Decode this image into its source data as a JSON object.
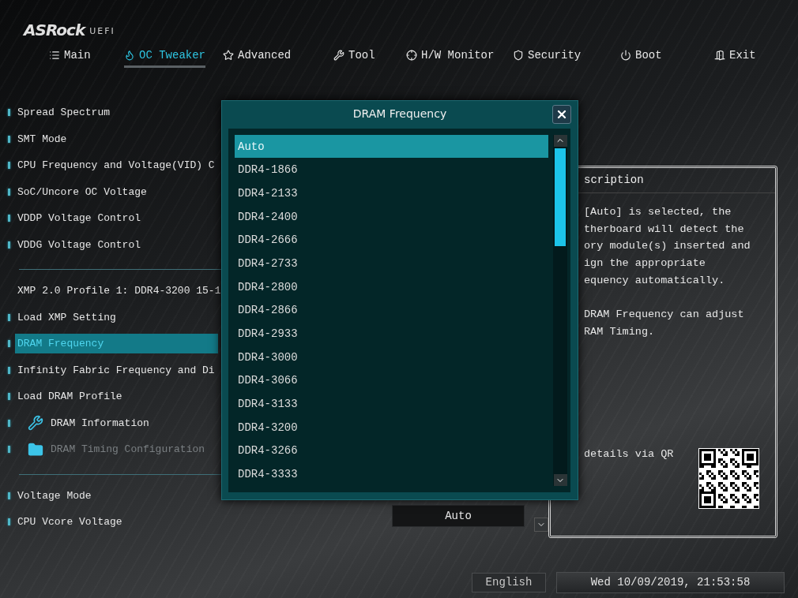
{
  "brand": {
    "logo": "ASRock",
    "suffix": "UEFI"
  },
  "tabs": [
    {
      "label": "Main",
      "selected": false
    },
    {
      "label": "OC Tweaker",
      "selected": true
    },
    {
      "label": "Advanced",
      "selected": false
    },
    {
      "label": "Tool",
      "selected": false
    },
    {
      "label": "H/W Monitor",
      "selected": false
    },
    {
      "label": "Security",
      "selected": false
    },
    {
      "label": "Boot",
      "selected": false
    },
    {
      "label": "Exit",
      "selected": false
    }
  ],
  "settings": [
    {
      "kind": "item",
      "label": "Spread Spectrum",
      "selected": false,
      "disabled": false
    },
    {
      "kind": "item",
      "label": "SMT Mode",
      "selected": false,
      "disabled": false
    },
    {
      "kind": "item",
      "label": "CPU Frequency and Voltage(VID) C",
      "selected": false,
      "disabled": false
    },
    {
      "kind": "item",
      "label": "SoC/Uncore OC Voltage",
      "selected": false,
      "disabled": false
    },
    {
      "kind": "item",
      "label": "VDDP Voltage Control",
      "selected": false,
      "disabled": false
    },
    {
      "kind": "item",
      "label": "VDDG Voltage Control",
      "selected": false,
      "disabled": false
    },
    {
      "kind": "divider"
    },
    {
      "kind": "info",
      "label": "XMP 2.0 Profile 1: DDR4-3200 15-1"
    },
    {
      "kind": "item",
      "label": "Load XMP Setting",
      "selected": false,
      "disabled": false
    },
    {
      "kind": "item",
      "label": "DRAM Frequency",
      "selected": true,
      "disabled": false
    },
    {
      "kind": "item",
      "label": "Infinity Fabric Frequency and Di",
      "selected": false,
      "disabled": false
    },
    {
      "kind": "item",
      "label": "Load DRAM Profile",
      "selected": false,
      "disabled": false
    },
    {
      "kind": "tool",
      "label": "DRAM Information",
      "selected": false,
      "disabled": false
    },
    {
      "kind": "folder",
      "label": "DRAM Timing Configuration",
      "selected": false,
      "disabled": true
    },
    {
      "kind": "divider"
    },
    {
      "kind": "item",
      "label": "Voltage Mode",
      "selected": false,
      "disabled": false
    },
    {
      "kind": "item",
      "label": "CPU Vcore Voltage",
      "selected": false,
      "disabled": false
    }
  ],
  "value_field": {
    "value": "Auto"
  },
  "description": {
    "title": "scription",
    "paragraphs": [
      [
        "[Auto] is selected, the",
        "therboard will detect the",
        "ory module(s) inserted and",
        "ign the appropriate",
        "equency automatically."
      ],
      [
        "DRAM Frequency can adjust",
        "RAM Timing."
      ]
    ],
    "qr_text": "details via QR"
  },
  "dialog": {
    "title": "DRAM Frequency",
    "options": [
      {
        "label": "Auto",
        "selected": true
      },
      {
        "label": "DDR4-1866",
        "selected": false
      },
      {
        "label": "DDR4-2133",
        "selected": false
      },
      {
        "label": "DDR4-2400",
        "selected": false
      },
      {
        "label": "DDR4-2666",
        "selected": false
      },
      {
        "label": "DDR4-2733",
        "selected": false
      },
      {
        "label": "DDR4-2800",
        "selected": false
      },
      {
        "label": "DDR4-2866",
        "selected": false
      },
      {
        "label": "DDR4-2933",
        "selected": false
      },
      {
        "label": "DDR4-3000",
        "selected": false
      },
      {
        "label": "DDR4-3066",
        "selected": false
      },
      {
        "label": "DDR4-3133",
        "selected": false
      },
      {
        "label": "DDR4-3200",
        "selected": false
      },
      {
        "label": "DDR4-3266",
        "selected": false
      },
      {
        "label": "DDR4-3333",
        "selected": false
      }
    ]
  },
  "footer": {
    "language": "English",
    "datetime": "Wed 10/09/2019, 21:53:58"
  }
}
